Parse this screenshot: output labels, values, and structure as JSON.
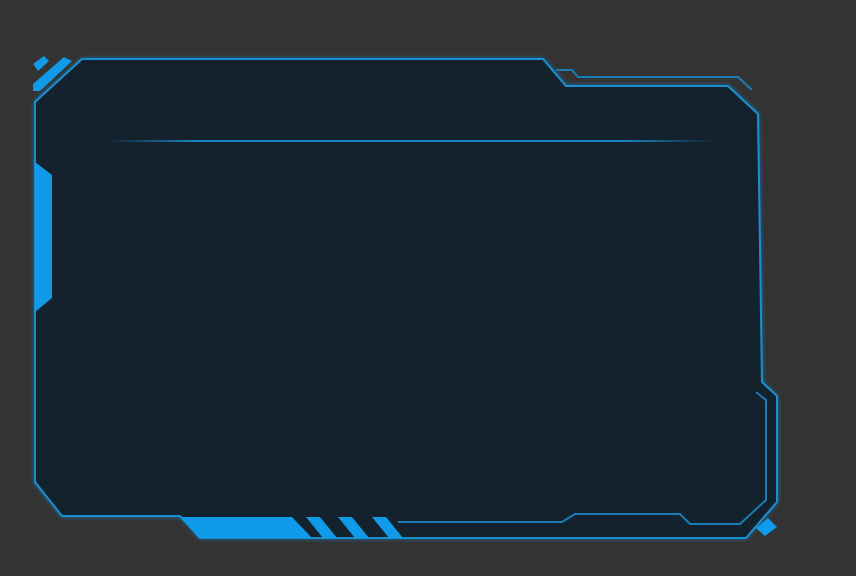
{
  "frame": {
    "background_color": "#333333",
    "panel_fill": "#14222E",
    "accent_color": "#119AE9",
    "border_color": "#1A8FD0",
    "glow_line_color": "#1B8FD0",
    "decor": [
      "corner-chevrons",
      "left-side-bar",
      "bottom-left-stripes",
      "bottom-right-corner-notch"
    ]
  }
}
